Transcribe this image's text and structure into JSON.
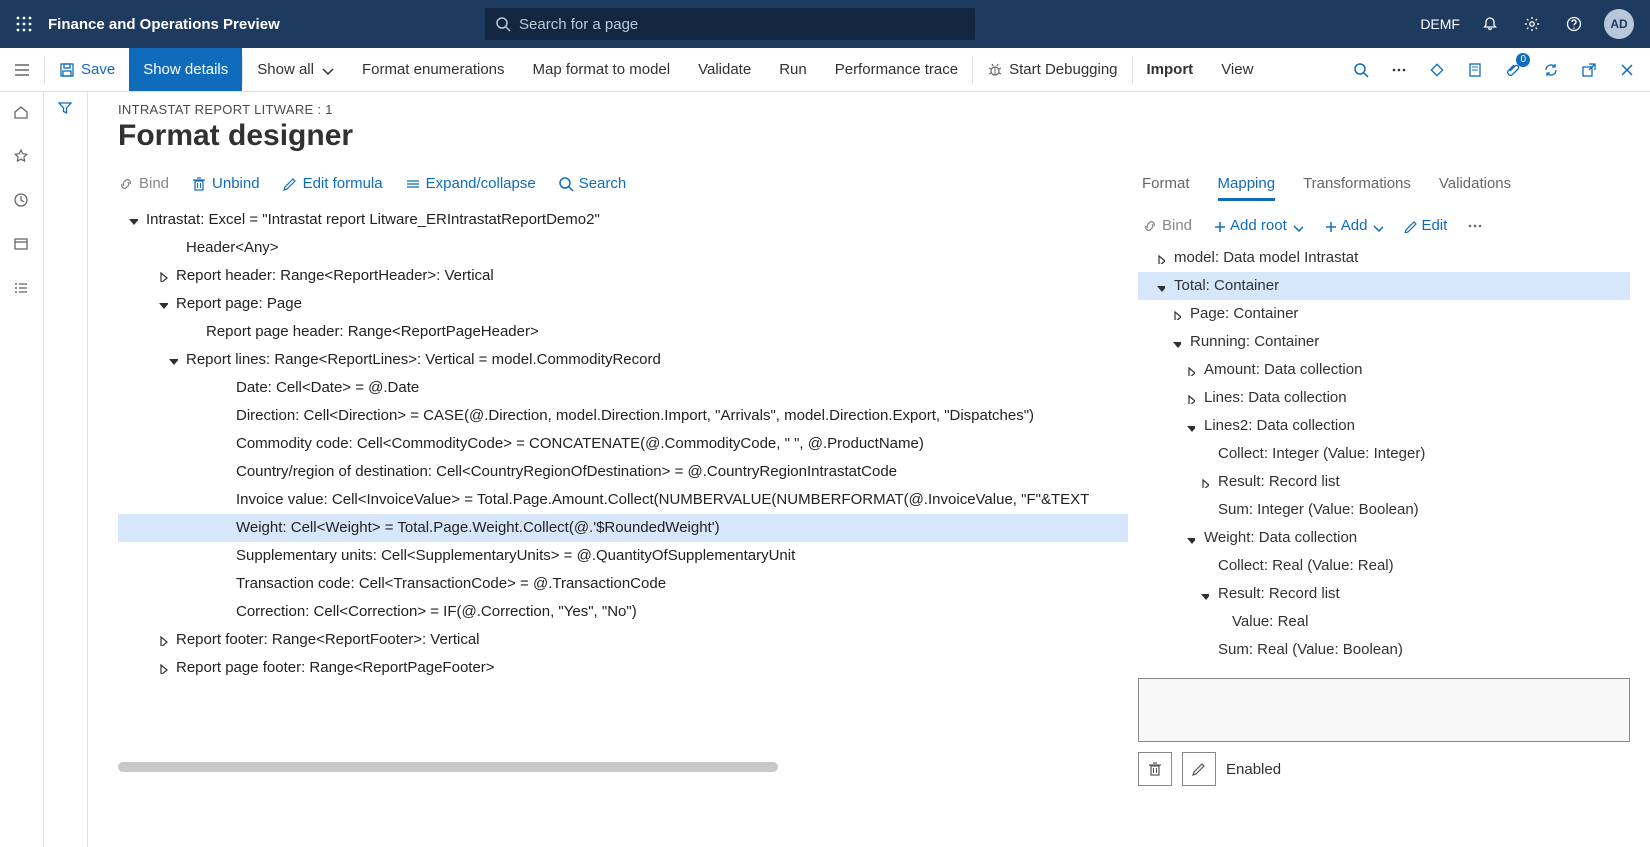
{
  "topbar": {
    "title": "Finance and Operations Preview",
    "search_placeholder": "Search for a page",
    "company": "DEMF",
    "avatar": "AD"
  },
  "cmdbar": {
    "save": "Save",
    "show_details": "Show details",
    "show_all": "Show all",
    "format_enum": "Format enumerations",
    "map_format": "Map format to model",
    "validate": "Validate",
    "run": "Run",
    "perf_trace": "Performance trace",
    "start_debug": "Start Debugging",
    "import": "Import",
    "view": "View",
    "badge_count": "0"
  },
  "header": {
    "breadcrumb": "INTRASTAT REPORT LITWARE : 1",
    "title": "Format designer"
  },
  "left_toolbar": {
    "bind": "Bind",
    "unbind": "Unbind",
    "edit_formula": "Edit formula",
    "expand": "Expand/collapse",
    "search": "Search"
  },
  "tree": {
    "n0": "Intrastat: Excel = \"Intrastat report Litware_ERIntrastatReportDemo2\"",
    "n1": "Header<Any>",
    "n2": "Report header: Range<ReportHeader>: Vertical",
    "n3": "Report page: Page",
    "n4": "Report page header: Range<ReportPageHeader>",
    "n5": "Report lines: Range<ReportLines>: Vertical = model.CommodityRecord",
    "n6": "Date: Cell<Date> = @.Date",
    "n7": "Direction: Cell<Direction> = CASE(@.Direction, model.Direction.Import, \"Arrivals\", model.Direction.Export, \"Dispatches\")",
    "n8": "Commodity code: Cell<CommodityCode> = CONCATENATE(@.CommodityCode, \" \", @.ProductName)",
    "n9": "Country/region of destination: Cell<CountryRegionOfDestination> = @.CountryRegionIntrastatCode",
    "n10": "Invoice value: Cell<InvoiceValue> = Total.Page.Amount.Collect(NUMBERVALUE(NUMBERFORMAT(@.InvoiceValue, \"F\"&TEXT",
    "n11": "Weight: Cell<Weight> = Total.Page.Weight.Collect(@.'$RoundedWeight')",
    "n12": "Supplementary units: Cell<SupplementaryUnits> = @.QuantityOfSupplementaryUnit",
    "n13": "Transaction code: Cell<TransactionCode> = @.TransactionCode",
    "n14": "Correction: Cell<Correction> = IF(@.Correction, \"Yes\", \"No\")",
    "n15": "Report footer: Range<ReportFooter>: Vertical",
    "n16": "Report page footer: Range<ReportPageFooter>"
  },
  "right_tabs": {
    "format": "Format",
    "mapping": "Mapping",
    "transformations": "Transformations",
    "validations": "Validations"
  },
  "right_toolbar": {
    "bind": "Bind",
    "add_root": "Add root",
    "add": "Add",
    "edit": "Edit"
  },
  "mtree": {
    "m0": "model: Data model Intrastat",
    "m1": "Total: Container",
    "m2": "Page: Container",
    "m3": "Running: Container",
    "m4": "Amount: Data collection",
    "m5": "Lines: Data collection",
    "m6": "Lines2: Data collection",
    "m7": "Collect: Integer (Value: Integer)",
    "m8": "Result: Record list",
    "m9": "Sum: Integer (Value: Boolean)",
    "m10": "Weight: Data collection",
    "m11": "Collect: Real (Value: Real)",
    "m12": "Result: Record list",
    "m13": "Value: Real",
    "m14": "Sum: Real (Value: Boolean)"
  },
  "detail": {
    "enabled_label": "Enabled"
  }
}
